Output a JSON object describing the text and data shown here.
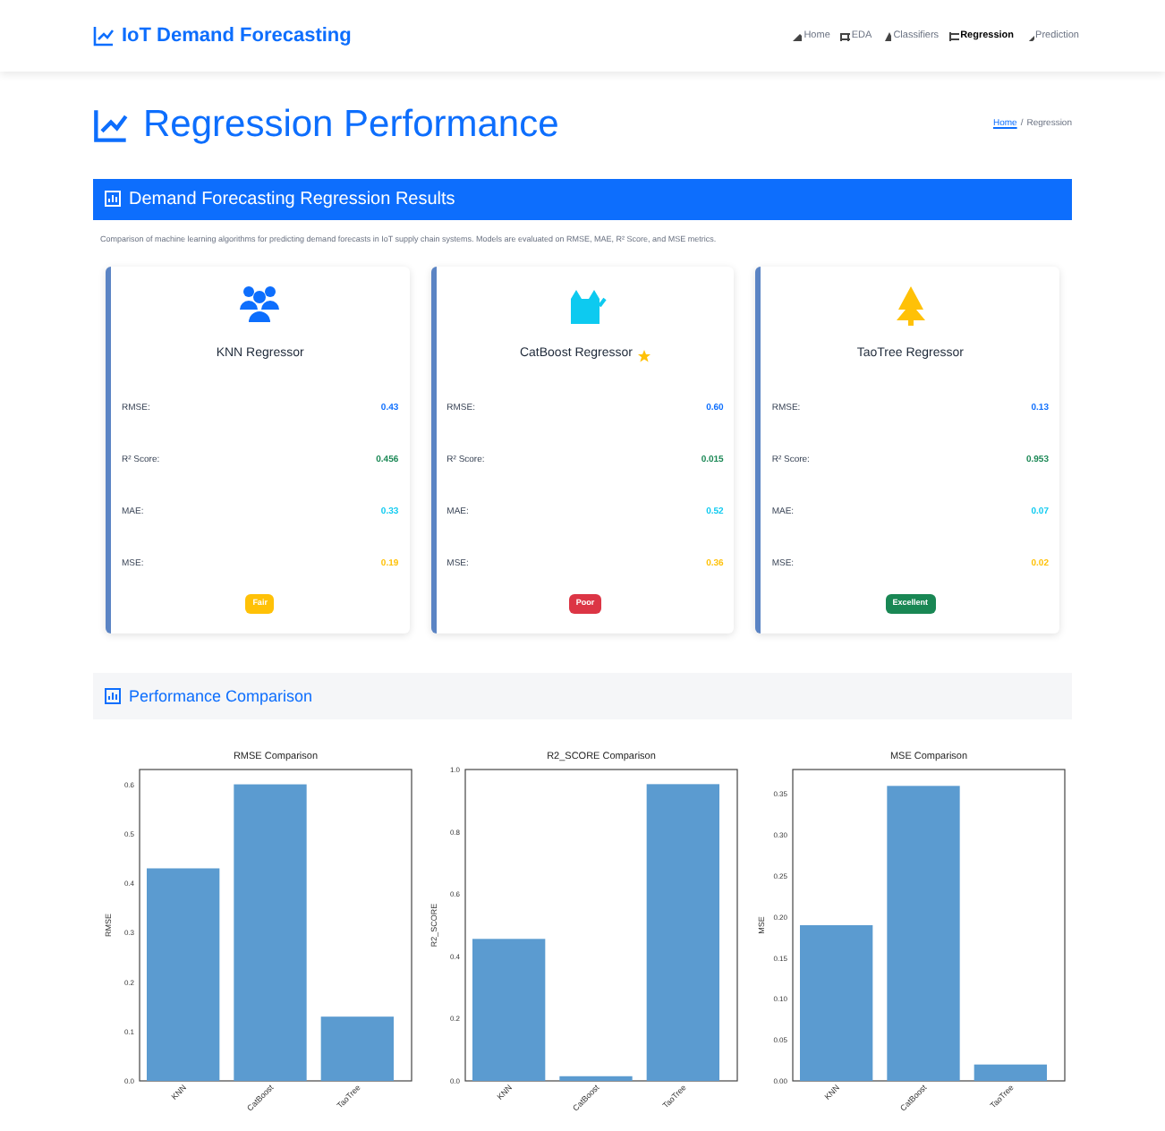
{
  "navbar": {
    "brand": "IoT Demand Forecasting",
    "links": [
      {
        "label": "Home",
        "selected": false
      },
      {
        "label": "EDA",
        "selected": false
      },
      {
        "label": "Classifiers",
        "selected": false
      },
      {
        "label": "Regression",
        "selected": true
      },
      {
        "label": "Prediction",
        "selected": false
      }
    ]
  },
  "page_title": "Regression Performance",
  "breadcrumb": {
    "link": "Home",
    "separator": "/",
    "current": "Regression"
  },
  "results_panel": {
    "title": "Demand Forecasting Regression Results",
    "description": "Comparison of machine learning algorithms for predicting demand forecasts in IoT supply chain systems. Models are evaluated on RMSE, MAE, R² Score, and MSE metrics.",
    "cards": [
      {
        "name": "KNN Regressor",
        "star": false,
        "metrics": [
          {
            "label": "RMSE:",
            "value": "0.43"
          },
          {
            "label": "R² Score:",
            "value": "0.456"
          },
          {
            "label": "MAE:",
            "value": "0.33"
          },
          {
            "label": "MSE:",
            "value": "0.19"
          }
        ],
        "badge": {
          "label": "Fair",
          "color": "#ffc107"
        }
      },
      {
        "name": "CatBoost Regressor",
        "star": true,
        "metrics": [
          {
            "label": "RMSE:",
            "value": "0.60"
          },
          {
            "label": "R² Score:",
            "value": "0.015"
          },
          {
            "label": "MAE:",
            "value": "0.52"
          },
          {
            "label": "MSE:",
            "value": "0.36"
          }
        ],
        "badge": {
          "label": "Poor",
          "color": "#dc3545"
        }
      },
      {
        "name": "TaoTree Regressor",
        "star": false,
        "metrics": [
          {
            "label": "RMSE:",
            "value": "0.13"
          },
          {
            "label": "R² Score:",
            "value": "0.953"
          },
          {
            "label": "MAE:",
            "value": "0.07"
          },
          {
            "label": "MSE:",
            "value": "0.02"
          }
        ],
        "badge": {
          "label": "Excellent",
          "color": "#198754"
        }
      }
    ]
  },
  "comparison_panel": {
    "title": "Performance Comparison",
    "charts": [
      {
        "chart_data": {
          "type": "bar",
          "title": "RMSE Comparison",
          "ylabel": "RMSE",
          "categories": [
            "KNN",
            "CatBoost",
            "TaoTree"
          ],
          "values": [
            0.43,
            0.6,
            0.13
          ],
          "ylim": [
            0,
            0.63
          ],
          "yticks": [
            {
              "value": 0,
              "label": "0.0"
            },
            0.1,
            0.2,
            0.3,
            0.4,
            0.5,
            0.6
          ]
        }
      },
      {
        "chart_data": {
          "type": "bar",
          "title": "R2_SCORE Comparison",
          "ylabel": "R2_SCORE",
          "categories": [
            "KNN",
            "CatBoost",
            "TaoTree"
          ],
          "values": [
            0.456,
            0.015,
            0.953
          ],
          "ylim": [
            0,
            1.0
          ],
          "yticks": [
            {
              "value": 0,
              "label": "0.0"
            },
            0.2,
            0.4,
            0.6,
            0.8,
            {
              "value": 1,
              "label": "1.0"
            }
          ]
        }
      },
      {
        "chart_data": {
          "type": "bar",
          "title": "MSE Comparison",
          "ylabel": "MSE",
          "categories": [
            "KNN",
            "CatBoost",
            "TaoTree"
          ],
          "values": [
            0.19,
            0.36,
            0.02
          ],
          "ylim": [
            0,
            0.38
          ],
          "yticks": [
            {
              "value": 0,
              "label": "0.00"
            },
            0.05,
            {
              "value": 0.1,
              "label": "0.10"
            },
            0.15,
            {
              "value": 0.2,
              "label": "0.20"
            },
            0.25,
            {
              "value": 0.3,
              "label": "0.30"
            },
            0.35
          ]
        }
      }
    ]
  }
}
